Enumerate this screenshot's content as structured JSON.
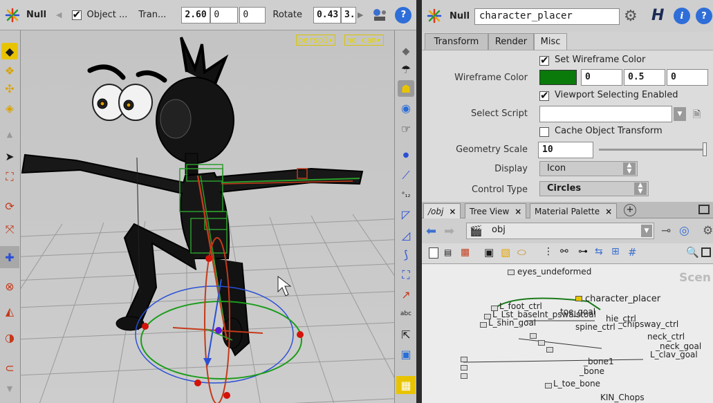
{
  "viewport_toolbar": {
    "node_type": "Null",
    "object_label": "Object ...",
    "translate_label": "Tran...",
    "translate_values": [
      "2.60",
      "0",
      "0"
    ],
    "rotate_label": "Rotate",
    "rotate_values": [
      "0.43",
      "3."
    ]
  },
  "viewport": {
    "persp_menu": "persp1▾",
    "cam_menu": "no cam▾"
  },
  "param_pane": {
    "node_type": "Null",
    "node_name": "character_placer",
    "tabs": [
      "Transform",
      "Render",
      "Misc"
    ],
    "active_tab": "Misc",
    "set_wireframe_color": "Set Wireframe Color",
    "wireframe_color_label": "Wireframe Color",
    "wireframe_color": "#0a7a0a",
    "wireframe_values": [
      "0",
      "0.5",
      "0"
    ],
    "viewport_selecting": "Viewport Selecting Enabled",
    "select_script_label": "Select Script",
    "cache_transform": "Cache Object Transform",
    "geometry_scale_label": "Geometry Scale",
    "geometry_scale_value": "10",
    "display_label": "Display",
    "display_value": "Icon",
    "control_type_label": "Control Type",
    "control_type_value": "Circles"
  },
  "network_pane": {
    "tabs": [
      "/obj",
      "Tree View",
      "Material Palette"
    ],
    "path": "obj",
    "scene_label": "Scen",
    "nodes": {
      "eyes": "eyes_undeformed",
      "character_placer": "character_placer",
      "foot_ctrl": "L_foot_ctrl",
      "toe_goal": "toe_goal",
      "ball_goal": "L_Lst_baselnt_pswalstoal",
      "shin_goal": "L_shin_goal",
      "hie_ctrl": "hie_ctrl",
      "spine_ctrl": "spine_ctrl",
      "hipsway": "_chipsway_ctrl",
      "neck_ctrl": "neck_ctrl",
      "neck_goal": "_neck_goal",
      "clav_goal": "L_clav_goal",
      "bone1": "_bone1",
      "bone": "_bone",
      "toe_bone": "L_toe_bone",
      "kin": "KIN_Chops"
    }
  }
}
